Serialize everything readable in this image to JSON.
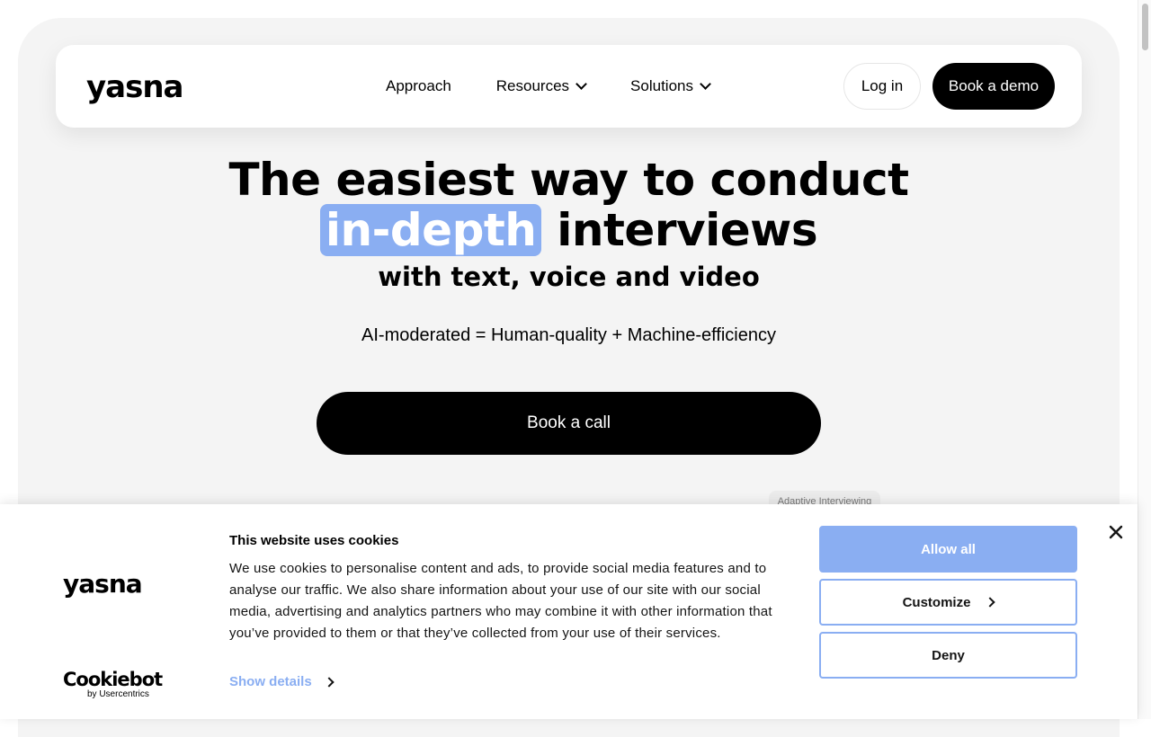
{
  "nav": {
    "logo": "yasna",
    "links": [
      "Approach",
      "Resources",
      "Solutions"
    ],
    "login_label": "Log in",
    "demo_label": "Book a demo"
  },
  "hero": {
    "title_line1": "The easiest way to conduct",
    "title_highlight": "in-depth",
    "title_rest": "interviews",
    "subtitle": "with text, voice and video",
    "tagline": "AI-moderated = Human-quality + Machine-efficiency",
    "cta_label": "Book a call",
    "chip_label": "Adaptive Interviewing"
  },
  "cookies": {
    "logo": "yasna",
    "provider_name": "Cookiebot",
    "provider_by": "by Usercentrics",
    "heading": "This website uses cookies",
    "body": "We use cookies to personalise content and ads, to provide social media features and to analyse our traffic. We also share information about your use of our site with our social media, advertising and analytics partners who may combine it with other information that you’ve provided to them or that they’ve collected from your use of their services.",
    "show_details_label": "Show details",
    "allow_label": "Allow all",
    "customize_label": "Customize",
    "deny_label": "Deny"
  },
  "colors": {
    "accent": "#8aaef2",
    "background": "#f4f4f4",
    "primary_button": "#000000"
  },
  "icons": {
    "dropdown": "chevron-down-icon",
    "details": "chevron-right-icon",
    "close": "close-icon"
  }
}
